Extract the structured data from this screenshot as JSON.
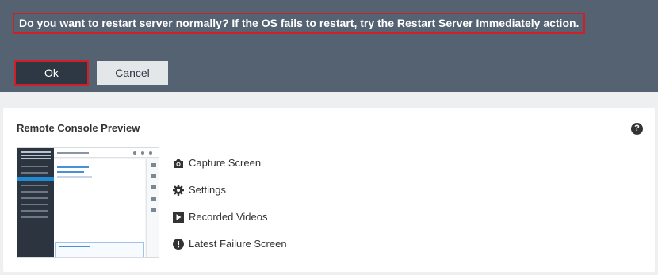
{
  "dialog": {
    "message": "Do you want to restart server normally? If the OS fails to restart, try the Restart Server Immediately action.",
    "ok_label": "Ok",
    "cancel_label": "Cancel"
  },
  "card": {
    "title": "Remote Console Preview",
    "help_icon": "question-circle-icon",
    "actions": [
      {
        "label": "Capture Screen",
        "icon": "camera-icon"
      },
      {
        "label": "Settings",
        "icon": "gear-icon"
      },
      {
        "label": "Recorded Videos",
        "icon": "play-icon"
      },
      {
        "label": "Latest Failure Screen",
        "icon": "alert-circle-icon"
      }
    ]
  },
  "colors": {
    "dialog_bg": "#546272",
    "highlight": "#d11f2a",
    "ok_bg": "#2e3844",
    "cancel_bg": "#e4e7ea"
  }
}
